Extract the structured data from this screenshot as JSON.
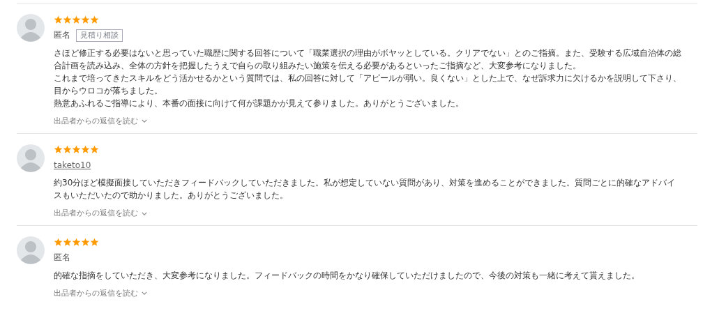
{
  "reviews": [
    {
      "stars": 5,
      "author": "匿名",
      "linked": false,
      "tag": "見積り相談",
      "paragraphs": [
        "さほど修正する必要はないと思っていた職歴に関する回答について「職業選択の理由がボヤッとしている。クリアでない」とのご指摘。また、受験する広域自治体の総合計画を読み込み、全体の方針を把握したうえで自らの取り組みたい施策を伝える必要があるといったご指摘など、大変参考になりました。",
        "これまで培ってきたスキルをどう活かせるかという質問では、私の回答に対して「アピールが弱い。良くない」とした上で、なぜ訴求力に欠けるかを説明して下さり、目からウロコが落ちました。",
        "熱意あふれるご指導により、本番の面接に向けて何が課題かが見えて参りました。ありがとうございました。"
      ],
      "reply_link": "出品者からの返信を読む"
    },
    {
      "stars": 5,
      "author": "taketo10",
      "linked": true,
      "paragraphs": [
        "約30分ほど模擬面接していただきフィードバックしていただきました。私が想定していない質問があり、対策を進めることができました。質問ごとに的確なアドバイスもいただいたので助かりました。ありがとうございました。"
      ],
      "reply_link": "出品者からの返信を読む"
    },
    {
      "stars": 5,
      "author": "匿名",
      "linked": false,
      "paragraphs": [
        "的確な指摘をしていただき、大変参考になりました。フィードバックの時間をかなり確保していただけましたので、今後の対策も一緒に考えて貰えました。"
      ],
      "reply_link": "出品者からの返信を読む"
    }
  ]
}
